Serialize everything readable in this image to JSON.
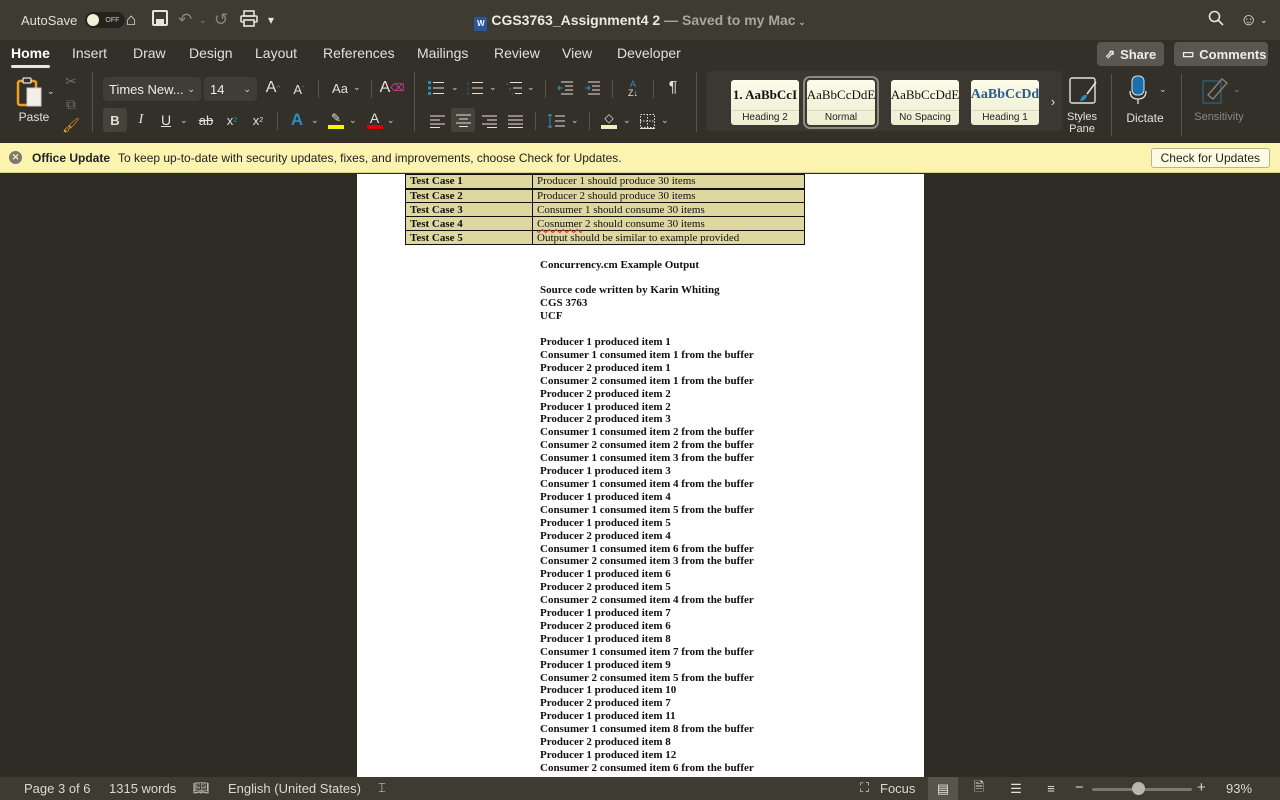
{
  "titlebar": {
    "autosave_label": "AutoSave",
    "autosave_state": "OFF",
    "doc_name": "CGS3763_Assignment4 2",
    "saved_status": "— Saved to my Mac",
    "icons": [
      "home-icon",
      "save-icon",
      "undo-icon",
      "redo-icon",
      "print-icon",
      "customize-toolbar-icon",
      "search-icon",
      "feedback-smiley-icon"
    ]
  },
  "menu": {
    "tabs": [
      "Home",
      "Insert",
      "Draw",
      "Design",
      "Layout",
      "References",
      "Mailings",
      "Review",
      "View",
      "Developer"
    ],
    "active_tab": "Home",
    "share_label": "Share",
    "comments_label": "Comments"
  },
  "ribbon": {
    "paste_label": "Paste",
    "font_name": "Times New...",
    "font_size": "14",
    "change_case_label": "Aa",
    "styles": [
      {
        "sample": "1.  AaBbCcI",
        "name": "Heading 2"
      },
      {
        "sample": "AaBbCcDdE",
        "name": "Normal",
        "selected": true
      },
      {
        "sample": "AaBbCcDdE",
        "name": "No Spacing"
      },
      {
        "sample": "AaBbCcDd",
        "name": "Heading 1"
      }
    ],
    "styles_pane_label": "Styles Pane",
    "dictate_label": "Dictate",
    "sensitivity_label": "Sensitivity",
    "colors": {
      "highlight": "#f5f500",
      "font_color": "#e00000",
      "accent": "#2b8ec0"
    }
  },
  "notification": {
    "title": "Office Update",
    "message": "To keep up-to-date with security updates, fixes, and improvements, choose Check for Updates.",
    "button_label": "Check for Updates"
  },
  "document": {
    "test_cases": [
      {
        "name": "Test Case 1",
        "description": "Producer 1 should produce 30 items"
      },
      {
        "name": "Test Case 2",
        "description": "Producer 2 should produce 30 items"
      },
      {
        "name": "Test Case 3",
        "description": "Consumer 1 should consume 30 items"
      },
      {
        "name": "Test Case 4",
        "description_misspelled": "Cosnumer",
        "description_rest": " 2 should consume 30 items"
      },
      {
        "name": "Test Case 5",
        "description": "Output should be similar to example provided"
      }
    ],
    "output_heading": "Concurrency.cm Example Output",
    "header_lines": [
      "Source code written by Karin Whiting",
      "CGS 3763",
      "UCF"
    ],
    "output_lines": [
      "Producer 1 produced item 1",
      "Consumer 1 consumed item 1 from the buffer",
      "Producer 2 produced item 1",
      "Consumer 2 consumed item 1 from the buffer",
      "Producer 2 produced item 2",
      "Producer 1 produced item 2",
      "Producer 2 produced item 3",
      "Consumer 1 consumed item 2 from the buffer",
      "Consumer 2 consumed item 2 from the buffer",
      "Consumer 1 consumed item 3 from the buffer",
      "Producer 1 produced item 3",
      "Consumer 1 consumed item 4 from the buffer",
      "Producer 1 produced item 4",
      "Consumer 1 consumed item 5 from the buffer",
      "Producer 1 produced item 5",
      "Producer 2 produced item 4",
      "Consumer 1 consumed item 6 from the buffer",
      "Consumer 2 consumed item 3 from the buffer",
      "Producer 1 produced item 6",
      "Producer 2 produced item 5",
      "Consumer 2 consumed item 4 from the buffer",
      "Producer 1 produced item 7",
      "Producer 2 produced item 6",
      "Producer 1 produced item 8",
      "Consumer 1 consumed item 7 from the buffer",
      "Producer 1 produced item 9",
      "Consumer 2 consumed item 5 from the buffer",
      "Producer 1 produced item 10",
      "Producer 2 produced item 7",
      "Producer 1 produced item 11",
      "Consumer 1 consumed item 8 from the buffer",
      "Producer 2 produced item 8",
      "Producer 1 produced item 12",
      "Consumer 2 consumed item 6 from the buffer"
    ]
  },
  "statusbar": {
    "page_info": "Page 3 of 6",
    "word_count": "1315 words",
    "language": "English (United States)",
    "focus_label": "Focus",
    "zoom_level": "93%",
    "zoom_fraction": 0.46
  }
}
